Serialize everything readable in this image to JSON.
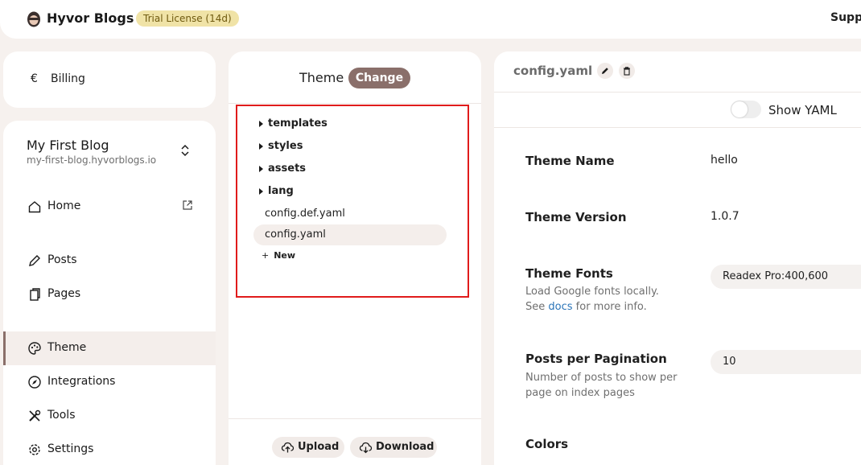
{
  "header": {
    "app_title": "Hyvor Blogs",
    "trial_badge": "Trial License (14d)",
    "support_label": "Suppo",
    "colors": {
      "badge_bg": "#f0e3a7",
      "accent": "#8a6f6a"
    }
  },
  "billing": {
    "currency_symbol": "€",
    "label": "Billing"
  },
  "blog": {
    "name": "My First Blog",
    "url": "my-first-blog.hyvorblogs.io"
  },
  "nav": {
    "home": "Home",
    "posts": "Posts",
    "pages": "Pages",
    "theme": "Theme",
    "integrations": "Integrations",
    "tools": "Tools",
    "settings": "Settings"
  },
  "theme_panel": {
    "title": "Theme",
    "change_label": "Change",
    "folders": [
      "templates",
      "styles",
      "assets",
      "lang"
    ],
    "files": [
      "config.def.yaml",
      "config.yaml"
    ],
    "selected_file": "config.yaml",
    "new_label": "New",
    "upload_label": "Upload",
    "download_label": "Download"
  },
  "config": {
    "file_name": "config.yaml",
    "show_yaml_label": "Show YAML",
    "show_yaml_enabled": false,
    "fields": {
      "theme_name": {
        "label": "Theme Name",
        "value": "hello"
      },
      "theme_version": {
        "label": "Theme Version",
        "value": "1.0.7"
      },
      "theme_fonts": {
        "label": "Theme Fonts",
        "desc_line1": "Load Google fonts locally.",
        "desc_prefix": "See",
        "desc_link": "docs",
        "desc_suffix": "for more info.",
        "value": "Readex Pro:400,600"
      },
      "posts_per_pagination": {
        "label": "Posts per Pagination",
        "desc": "Number of posts to show per page on index pages",
        "value": "10"
      },
      "colors": {
        "label": "Colors"
      }
    }
  }
}
